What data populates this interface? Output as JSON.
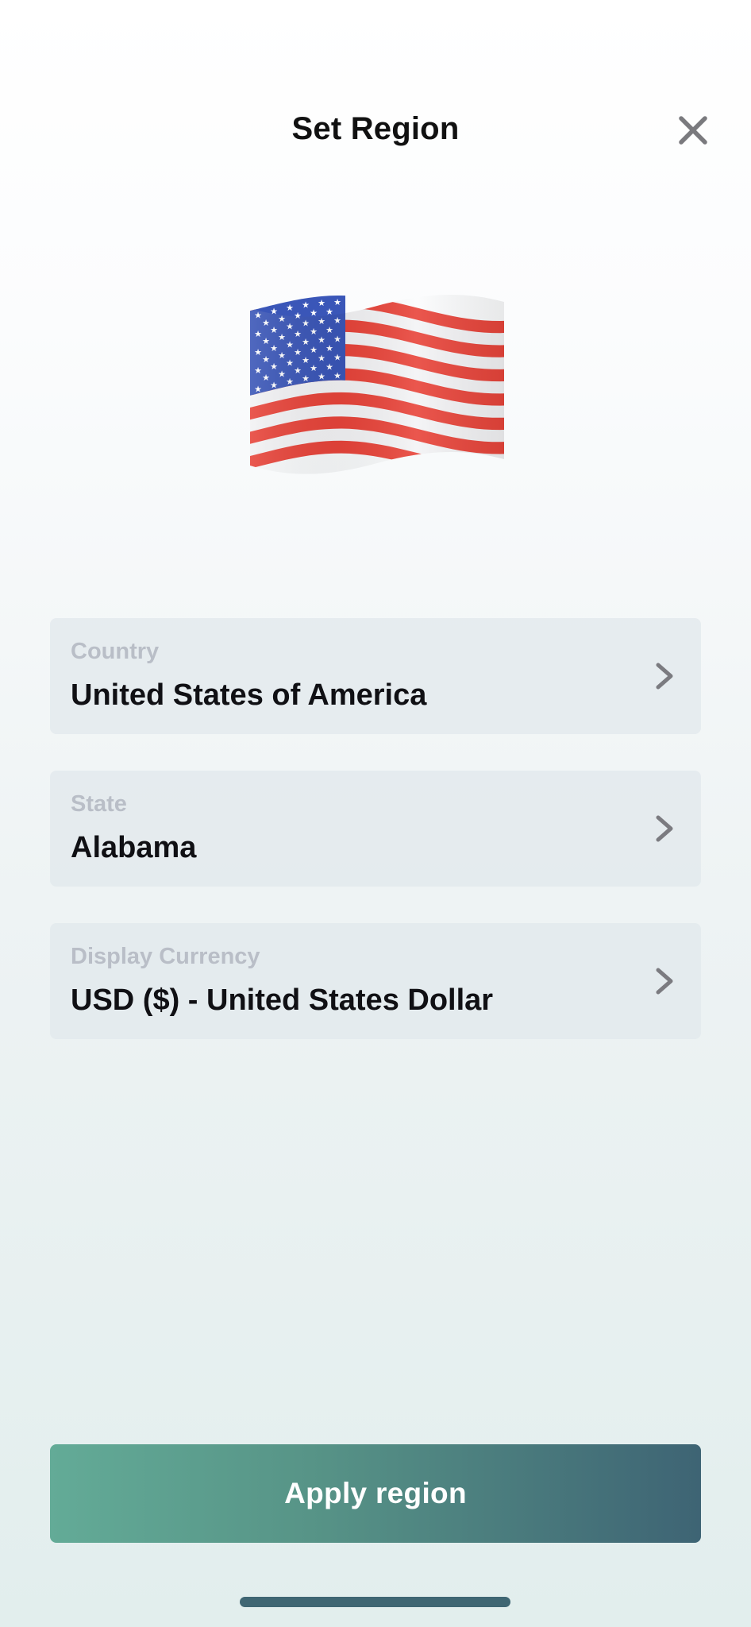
{
  "header": {
    "title": "Set Region",
    "close_icon": "close-icon"
  },
  "flag": {
    "icon": "us-flag-icon",
    "colors": {
      "red": "#e8443a",
      "white": "#f3f3f5",
      "blue": "#3a56b8"
    }
  },
  "fields": [
    {
      "label": "Country",
      "value": "United States of America",
      "icon": "chevron-right-icon"
    },
    {
      "label": "State",
      "value": "Alabama",
      "icon": "chevron-right-icon"
    },
    {
      "label": "Display Currency",
      "value": "USD ($) - United States Dollar",
      "icon": "chevron-right-icon"
    }
  ],
  "apply_button": {
    "label": "Apply region",
    "gradient": [
      "#63ab97",
      "#3e6474"
    ]
  },
  "colors": {
    "label_gray": "#b9bec7",
    "field_bg": "#e4eaee",
    "accent_dark": "#3f6673"
  }
}
